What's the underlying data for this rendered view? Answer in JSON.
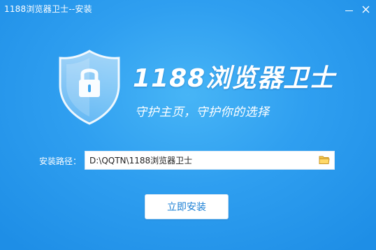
{
  "window": {
    "title": "1188浏览器卫士--安装"
  },
  "hero": {
    "brand_name": "1188浏览器卫士",
    "slogan": "守护主页，守护你的选择"
  },
  "install_path": {
    "label": "安装路径：",
    "value": "D:\\QQTN\\1188浏览器卫士"
  },
  "actions": {
    "install_label": "立即安装"
  },
  "icons": {
    "minimize": "minimize-icon",
    "close": "close-icon",
    "shield": "shield-lock-icon",
    "folder": "folder-icon"
  },
  "colors": {
    "background": "#2f9ff0",
    "accent_text": "#1a7fd5"
  }
}
